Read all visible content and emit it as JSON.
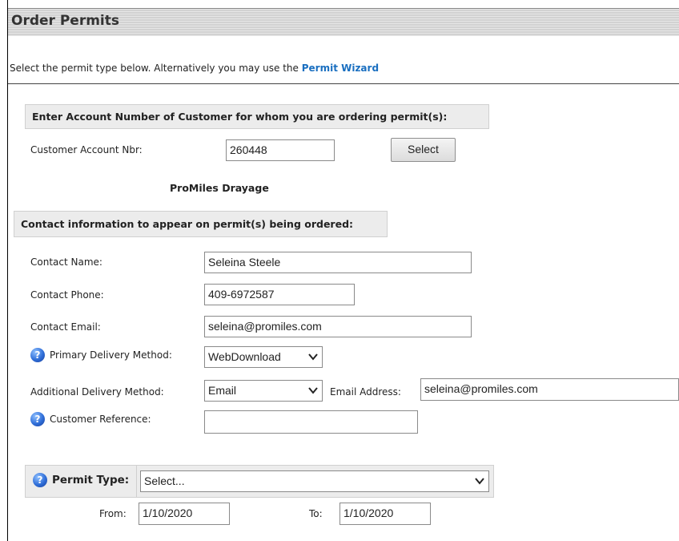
{
  "header": {
    "title": "Order Permits"
  },
  "intro": {
    "text": "Select the permit type below. Alternatively you may use the ",
    "link_label": "Permit Wizard"
  },
  "account_section": {
    "heading": "Enter Account Number of Customer for whom you are ordering permit(s):",
    "account_label": "Customer Account Nbr:",
    "account_value": "260448",
    "select_button": "Select",
    "company_name": "ProMiles Drayage"
  },
  "contact_section": {
    "heading": "Contact information to appear on permit(s) being ordered:",
    "name_label": "Contact Name:",
    "name_value": "Seleina Steele",
    "phone_label": "Contact Phone:",
    "phone_value": "409-6972587",
    "email_label": "Contact Email:",
    "email_value": "seleina@promiles.com",
    "primary_label": "Primary Delivery Method:",
    "primary_value": "WebDownload",
    "additional_label": "Additional Delivery Method:",
    "additional_value": "Email",
    "email_address_label": "Email Address:",
    "email_address_value": "seleina@promiles.com",
    "reference_label": "Customer Reference:",
    "reference_value": ""
  },
  "permit_section": {
    "type_label": "Permit Type:",
    "type_value": "Select...",
    "from_label": "From:",
    "from_value": "1/10/2020",
    "to_label": "To:",
    "to_value": "1/10/2020"
  },
  "icons": {
    "help": "help-circle-icon",
    "dropdown": "chevron-down-icon"
  },
  "colors": {
    "link": "#1a6fc0",
    "help_icon": "#2f6ed8",
    "section_bg": "#ececec"
  }
}
